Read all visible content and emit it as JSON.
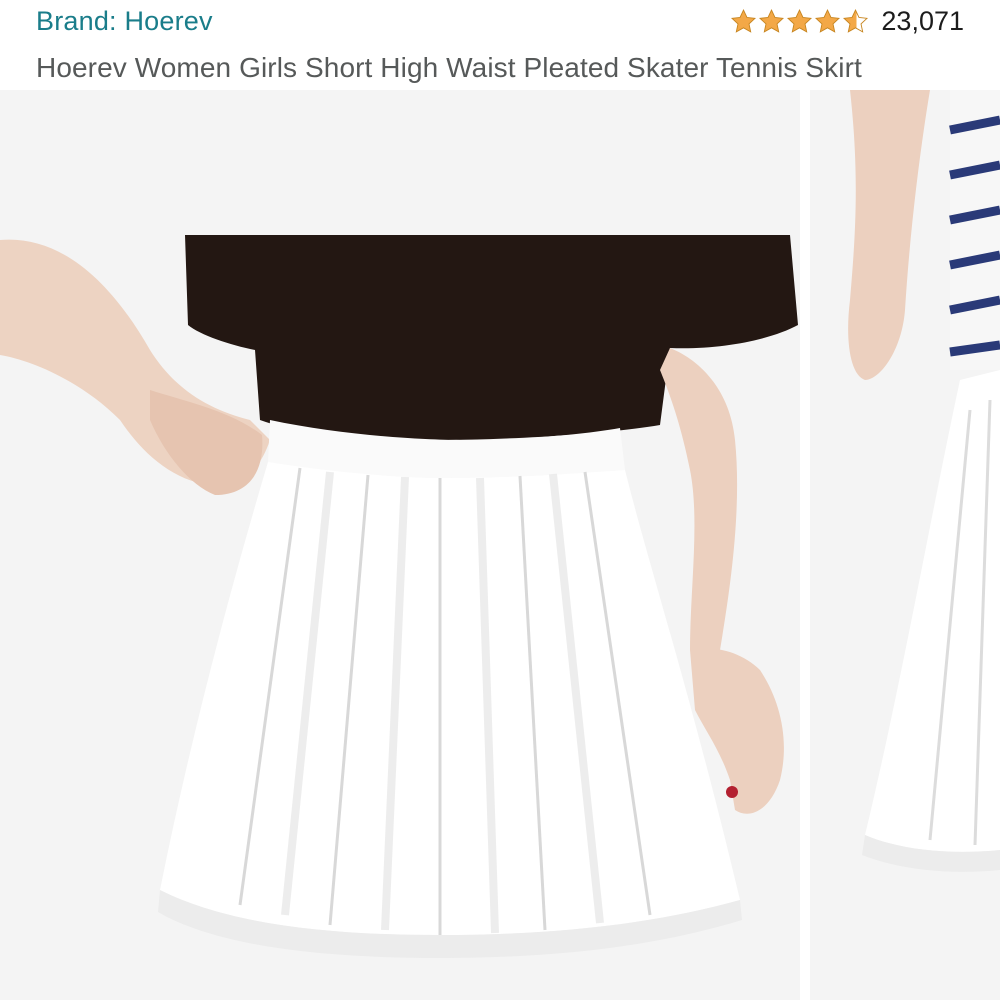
{
  "product": {
    "brand_label": "Brand: Hoerev",
    "title": "Hoerev Women Girls Short High Waist Pleated Skater Tennis Skirt",
    "rating": 4.5,
    "review_count": "23,071"
  },
  "colors": {
    "brand_link": "#1a7d8a",
    "star": "#f3a847",
    "title_text": "#565959"
  },
  "icons": [
    "star-icon",
    "half-star-icon"
  ]
}
